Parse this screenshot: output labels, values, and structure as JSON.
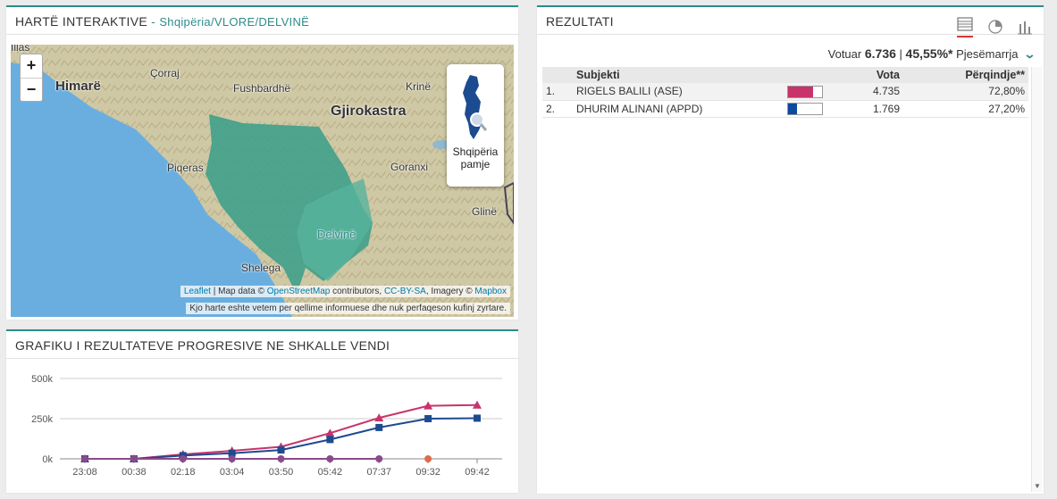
{
  "map_panel": {
    "title": "HARTË INTERAKTIVE",
    "separator": " - ",
    "breadcrumb": "Shqipëria/VLORE/DELVINË",
    "zoom_in": "+",
    "zoom_out": "−",
    "view_button": {
      "line1": "Shqipëria",
      "line2": "pamje"
    },
    "places": [
      "Himarë",
      "Çorraj",
      "Fushbardhë",
      "Krinë",
      "Gjirokastra",
      "Piqeras",
      "Goranxi",
      "Glinë",
      "Delvinë",
      "Shelega",
      "Illas"
    ],
    "attribution": {
      "leaflet": "Leaflet",
      "text1": " | Map data © ",
      "osm": "OpenStreetMap",
      "text2": " contributors, ",
      "license": "CC-BY-SA",
      "text3": ", Imagery © ",
      "mapbox": "Mapbox"
    },
    "disclaimer": "Kjo harte eshte vetem per qellime informuese dhe nuk perfaqeson kufinj zyrtare.",
    "colors": {
      "region": "#3fa08a",
      "sea": "#6aaee0",
      "land": "#c9c4a2"
    }
  },
  "chart_panel": {
    "title": "GRAFIKU I REZULTATEVE PROGRESIVE NE SHKALLE VENDI"
  },
  "chart_data": {
    "type": "line",
    "categories": [
      "23:08",
      "00:38",
      "02:18",
      "03:04",
      "03:50",
      "05:42",
      "07:37",
      "09:32",
      "09:42"
    ],
    "y_tick_labels": [
      "500k",
      "250k",
      "0k"
    ],
    "ylim": [
      0,
      500000
    ],
    "series": [
      {
        "color": "#c8336b",
        "marker": "triangle",
        "values": [
          0,
          0,
          28000,
          50000,
          75000,
          160000,
          255000,
          330000,
          335000
        ]
      },
      {
        "color": "#1d4b8f",
        "marker": "square",
        "values": [
          0,
          0,
          20000,
          35000,
          55000,
          120000,
          195000,
          250000,
          253000
        ]
      },
      {
        "color": "#e06a4a",
        "marker": "circle",
        "values": [
          null,
          null,
          null,
          null,
          null,
          null,
          null,
          0,
          null
        ]
      },
      {
        "color": "#8b4a8b",
        "marker": "circle",
        "values": [
          0,
          0,
          0,
          0,
          0,
          0,
          0,
          null,
          null
        ]
      }
    ]
  },
  "results_panel": {
    "title": "REZULTATI",
    "icons": [
      "table-icon",
      "pie-chart-icon",
      "bar-chart-icon"
    ],
    "voted_label": "Votuar",
    "voted_value": "6.736",
    "divider": "|",
    "turnout_value": "45,55%*",
    "turnout_label": "Pjesëmarrja",
    "chevron": "⌄",
    "columns": {
      "subject": "Subjekti",
      "votes": "Vota",
      "percent": "Përqindje**"
    },
    "rows": [
      {
        "rank": "1.",
        "name": "RIGELS BALILI (ASE)",
        "votes": "4.735",
        "percent": "72,80%",
        "share": 0.728,
        "color": "#c8336b"
      },
      {
        "rank": "2.",
        "name": "DHURIM ALINANI (APPD)",
        "votes": "1.769",
        "percent": "27,20%",
        "share": 0.272,
        "color": "#0b4a9e"
      }
    ]
  }
}
